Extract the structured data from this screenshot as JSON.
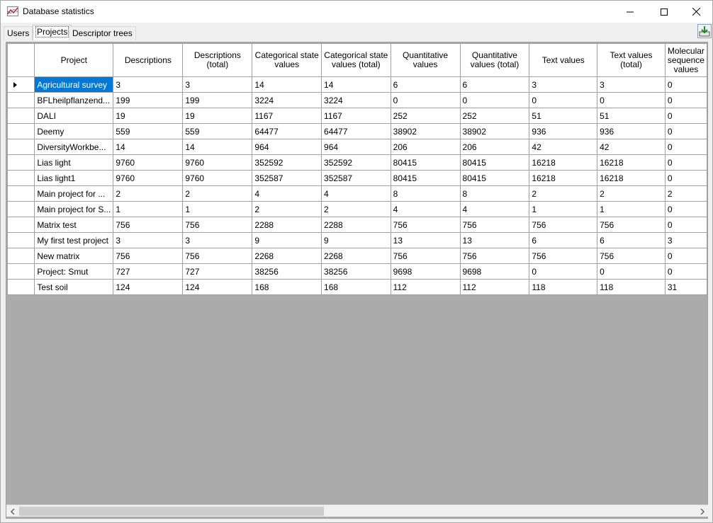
{
  "window": {
    "title": "Database statistics",
    "minimize_icon": "minimize-icon",
    "maximize_icon": "maximize-icon",
    "close_icon": "close-icon"
  },
  "tabs": [
    {
      "label": "Users",
      "active": false
    },
    {
      "label": "Projects",
      "active": true
    },
    {
      "label": "Descriptor trees",
      "active": false
    }
  ],
  "toolbar": {
    "export_icon": "export-icon"
  },
  "grid": {
    "columns": [
      "Project",
      "Descriptions",
      "Descriptions (total)",
      "Categorical state values",
      "Categorical state values (total)",
      "Quantitative values",
      "Quantitative values (total)",
      "Text values",
      "Text values (total)",
      "Molecular sequence values"
    ],
    "rows": [
      [
        "Agricultural survey",
        "3",
        "3",
        "14",
        "14",
        "6",
        "6",
        "3",
        "3",
        "0"
      ],
      [
        "BFLheilpflanzend...",
        "199",
        "199",
        "3224",
        "3224",
        "0",
        "0",
        "0",
        "0",
        "0"
      ],
      [
        "DALI",
        "19",
        "19",
        "1167",
        "1167",
        "252",
        "252",
        "51",
        "51",
        "0"
      ],
      [
        "Deemy",
        "559",
        "559",
        "64477",
        "64477",
        "38902",
        "38902",
        "936",
        "936",
        "0"
      ],
      [
        "DiversityWorkbe...",
        "14",
        "14",
        "964",
        "964",
        "206",
        "206",
        "42",
        "42",
        "0"
      ],
      [
        "Lias light",
        "9760",
        "9760",
        "352592",
        "352592",
        "80415",
        "80415",
        "16218",
        "16218",
        "0"
      ],
      [
        "Lias light1",
        "9760",
        "9760",
        "352587",
        "352587",
        "80415",
        "80415",
        "16218",
        "16218",
        "0"
      ],
      [
        "Main project for ...",
        "2",
        "2",
        "4",
        "4",
        "8",
        "8",
        "2",
        "2",
        "2"
      ],
      [
        "Main project for S...",
        "1",
        "1",
        "2",
        "2",
        "4",
        "4",
        "1",
        "1",
        "0"
      ],
      [
        "Matrix test",
        "756",
        "756",
        "2288",
        "2288",
        "756",
        "756",
        "756",
        "756",
        "0"
      ],
      [
        "My first test project",
        "3",
        "3",
        "9",
        "9",
        "13",
        "13",
        "6",
        "6",
        "3"
      ],
      [
        "New matrix",
        "756",
        "756",
        "2268",
        "2268",
        "756",
        "756",
        "756",
        "756",
        "0"
      ],
      [
        "Project: Smut",
        "727",
        "727",
        "38256",
        "38256",
        "9698",
        "9698",
        "0",
        "0",
        "0"
      ],
      [
        "Test soil",
        "124",
        "124",
        "168",
        "168",
        "112",
        "112",
        "118",
        "118",
        "31"
      ]
    ],
    "selected_row": 0
  },
  "scrollbar": {
    "horizontal_position": 0.0
  }
}
